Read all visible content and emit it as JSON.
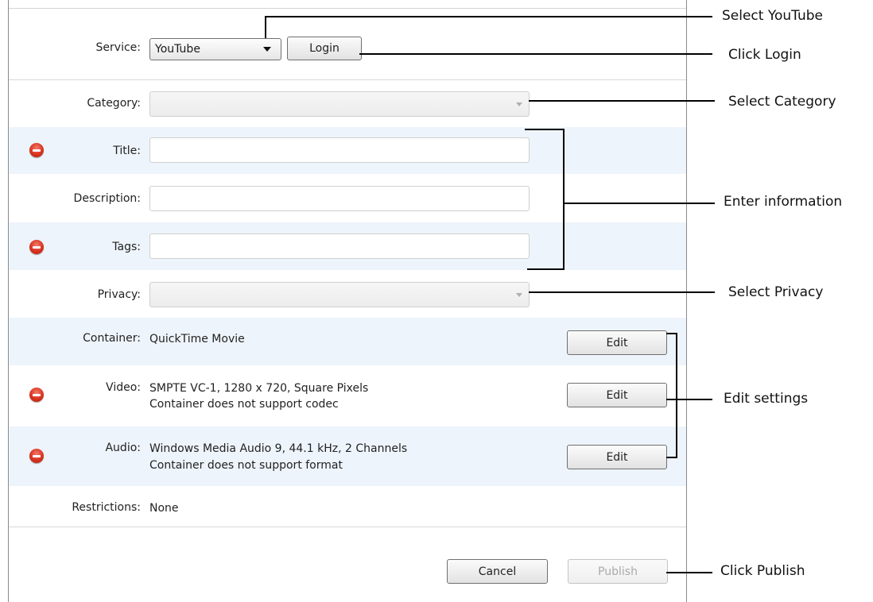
{
  "service": {
    "label": "Service:",
    "selected": "YouTube",
    "login_label": "Login"
  },
  "fields": {
    "category": {
      "label": "Category:"
    },
    "title": {
      "label": "Title:",
      "value": ""
    },
    "description": {
      "label": "Description:",
      "value": ""
    },
    "tags": {
      "label": "Tags:",
      "value": ""
    },
    "privacy": {
      "label": "Privacy:"
    }
  },
  "settings": {
    "container": {
      "label": "Container:",
      "value": "QuickTime Movie",
      "edit_label": "Edit"
    },
    "video": {
      "label": "Video:",
      "line1": "SMPTE VC-1, 1280 x 720, Square Pixels",
      "line2": "Container does not support codec",
      "edit_label": "Edit"
    },
    "audio": {
      "label": "Audio:",
      "line1": "Windows Media Audio 9, 44.1 kHz, 2 Channels",
      "line2": "Container does not support format",
      "edit_label": "Edit"
    },
    "restrictions": {
      "label": "Restrictions:",
      "value": "None"
    }
  },
  "actions": {
    "cancel_label": "Cancel",
    "publish_label": "Publish"
  },
  "annotations": {
    "select_youtube": "Select YouTube",
    "click_login": "Click Login",
    "select_category": "Select Category",
    "enter_information": "Enter information",
    "select_privacy": "Select Privacy",
    "edit_settings": "Edit settings",
    "click_publish": "Click Publish"
  },
  "colors": {
    "band": "#eef4fb",
    "error_icon": "#d8321f"
  }
}
